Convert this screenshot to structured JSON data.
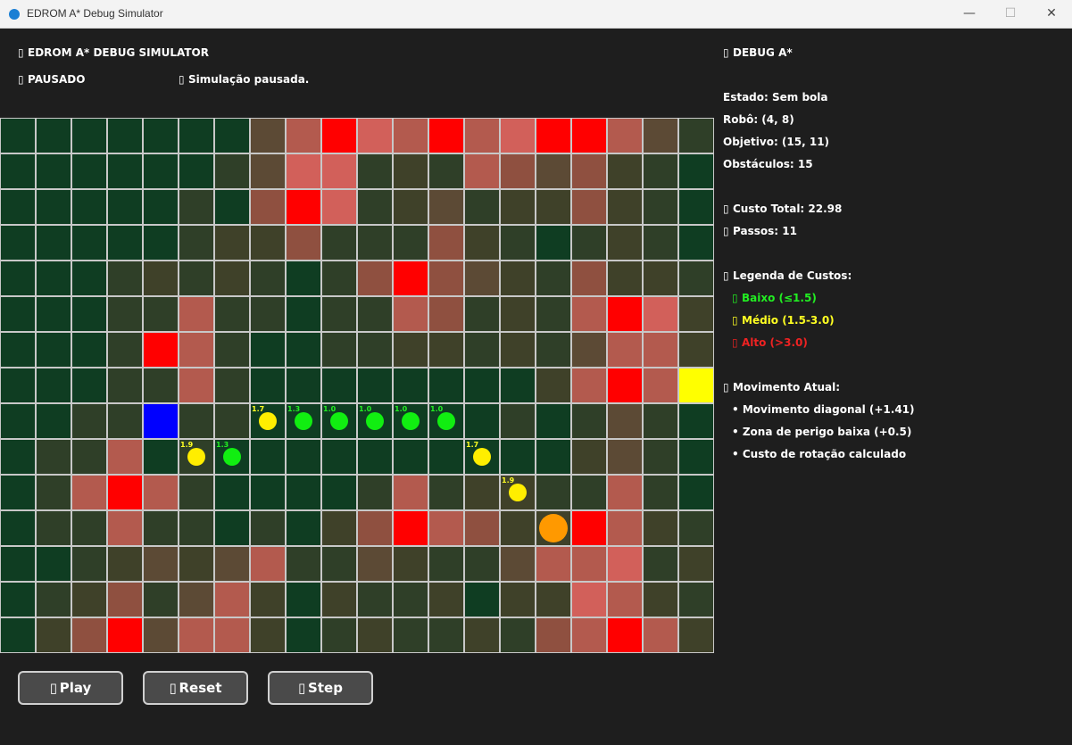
{
  "window": {
    "title": "EDROM A* Debug Simulator",
    "minimize_glyph": "—",
    "maximize_glyph": "☐",
    "close_glyph": "✕"
  },
  "header": {
    "title": "EDROM A* DEBUG SIMULATOR",
    "status": "PAUSADO",
    "message": "Simulação pausada."
  },
  "debug": {
    "title": "DEBUG A*",
    "state": "Estado: Sem bola",
    "robot": "Robô: (4, 8)",
    "goal": "Objetivo: (15, 11)",
    "obstacles": "Obstáculos: 15",
    "total_cost": "Custo Total: 22.98",
    "steps": "Passos: 11",
    "legend_title": "Legenda de Custos:",
    "legend": [
      {
        "label": "Baixo (≤1.5)",
        "color": "#22ee22"
      },
      {
        "label": "Médio (1.5-3.0)",
        "color": "#ffff22"
      },
      {
        "label": "Alto (>3.0)",
        "color": "#ee2222"
      }
    ],
    "movement_title": "Movimento Atual:",
    "movement_items": [
      "• Movimento diagonal (+1.41)",
      "• Zona de perigo baixa (+0.5)",
      "• Custo de rotação calculado"
    ]
  },
  "grid": {
    "cols": 20,
    "rows": 15,
    "palette": {
      "0": "#0f3d22",
      "1": "#2f3f28",
      "2": "#3f4129",
      "3": "#5c4a35",
      "4": "#8f5040",
      "5": "#b35a4e",
      "6": "#d2605a",
      "7": "#ff0000",
      "B": "#0000ff",
      "Y": "#ffff00"
    },
    "rows_data": [
      "00000003576575677531",
      "00000013661215434210",
      "00000104761231224210",
      "00000122411142101210",
      "00012121014743214221",
      "00011511011541215762",
      "00017510011221213552",
      "0001151000000002575Y",
      "0011B110000000101310",
      "01150100000000002310",
      "01575100001512211510",
      "01151101024754227521",
      "00123235113211355612",
      "01241352021120226521",
      "02473552012112145752"
    ],
    "robot": {
      "col": 4,
      "row": 8
    },
    "goal": {
      "col": 19,
      "row": 7
    },
    "path": [
      {
        "col": 5,
        "row": 9,
        "cost": "1.9",
        "level": "medium"
      },
      {
        "col": 6,
        "row": 9,
        "cost": "1.3",
        "level": "low"
      },
      {
        "col": 7,
        "row": 8,
        "cost": "1.7",
        "level": "medium"
      },
      {
        "col": 8,
        "row": 8,
        "cost": "1.3",
        "level": "low"
      },
      {
        "col": 9,
        "row": 8,
        "cost": "1.0",
        "level": "low"
      },
      {
        "col": 10,
        "row": 8,
        "cost": "1.0",
        "level": "low"
      },
      {
        "col": 11,
        "row": 8,
        "cost": "1.0",
        "level": "low"
      },
      {
        "col": 12,
        "row": 8,
        "cost": "1.0",
        "level": "low"
      },
      {
        "col": 13,
        "row": 9,
        "cost": "1.7",
        "level": "medium"
      },
      {
        "col": 14,
        "row": 10,
        "cost": "1.9",
        "level": "medium"
      },
      {
        "col": 15,
        "row": 11,
        "cost": "",
        "level": "current"
      }
    ],
    "level_colors": {
      "low": "#11ee11",
      "medium": "#ffee00",
      "current": "#ff9900"
    },
    "label_colors": {
      "low": "#22ee22",
      "medium": "#ffff22",
      "current": "#ee2222"
    }
  },
  "buttons": {
    "play": "Play",
    "reset": "Reset",
    "step": "Step"
  }
}
